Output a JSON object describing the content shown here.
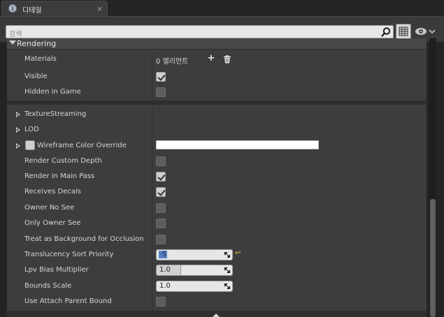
{
  "tab": {
    "title": "디테일",
    "close": "×"
  },
  "search": {
    "placeholder": "검색"
  },
  "category": {
    "title": "Rendering"
  },
  "materials": {
    "label": "Materials",
    "value": "0 엘리먼트",
    "add": "+",
    "delete": "🗑"
  },
  "props_top": [
    {
      "label": "Visible",
      "checked": true
    },
    {
      "label": "Hidden in Game",
      "checked": false
    }
  ],
  "collapsed": [
    {
      "label": "TextureStreaming"
    },
    {
      "label": "LOD"
    }
  ],
  "wireframe": {
    "label": "Wireframe Color Override",
    "color": "#ffffff"
  },
  "props_bottom": [
    {
      "label": "Render Custom Depth",
      "checked": false
    },
    {
      "label": "Render in Main Pass",
      "checked": true
    },
    {
      "label": "Receives Decals",
      "checked": true
    },
    {
      "label": "Owner No See",
      "checked": false
    },
    {
      "label": "Only Owner See",
      "checked": false
    },
    {
      "label": "Treat as Background for Occlusion",
      "checked": false
    }
  ],
  "numeric": [
    {
      "label": "Translucency Sort Priority",
      "value": "-5"
    },
    {
      "label": "Lpv Bias Multiplier",
      "value": "1.0"
    },
    {
      "label": "Bounds Scale",
      "value": "1.0"
    }
  ],
  "last": {
    "label": "Use Attach Parent Bound",
    "checked": false
  },
  "colors": {
    "panel": "#3d3d3d",
    "accent": "#d9c43a",
    "selection": "#5a85c9"
  }
}
